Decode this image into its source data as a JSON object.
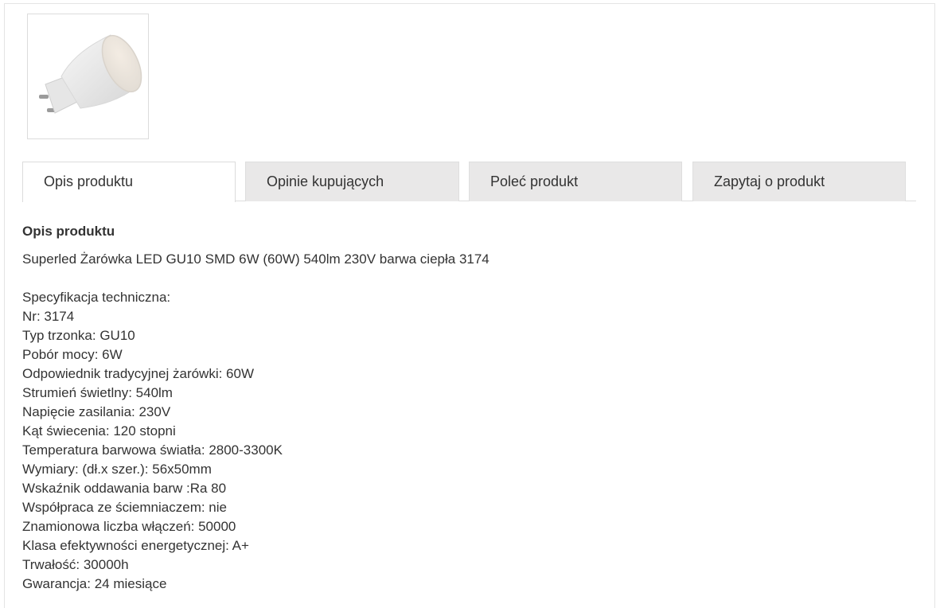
{
  "product_image": {
    "alt": "Superled Żarówka LED GU10 SMD 6W"
  },
  "tabs": [
    {
      "label": "Opis produktu",
      "active": true
    },
    {
      "label": "Opinie kupujących",
      "active": false
    },
    {
      "label": "Poleć produkt",
      "active": false
    },
    {
      "label": "Zapytaj o produkt",
      "active": false
    }
  ],
  "description": {
    "heading": "Opis produktu",
    "intro": "Superled Żarówka LED GU10 SMD 6W (60W) 540lm 230V barwa ciepła 3174",
    "spec_title": "Specyfikacja techniczna:",
    "specs": [
      "Nr: 3174",
      "Typ trzonka: GU10",
      "Pobór mocy: 6W",
      "Odpowiednik tradycyjnej żarówki: 60W",
      "Strumień świetlny: 540lm",
      "Napięcie zasilania: 230V",
      "Kąt świecenia: 120 stopni",
      "Temperatura barwowa światła: 2800-3300K",
      "Wymiary: (dł.x szer.): 56x50mm",
      "Wskaźnik oddawania barw :Ra 80",
      "Współpraca ze ściemniaczem: nie",
      "Znamionowa liczba włączeń: 50000",
      "Klasa efektywności energetycznej: A+",
      "Trwałość: 30000h",
      "Gwarancja: 24 miesiące"
    ]
  }
}
